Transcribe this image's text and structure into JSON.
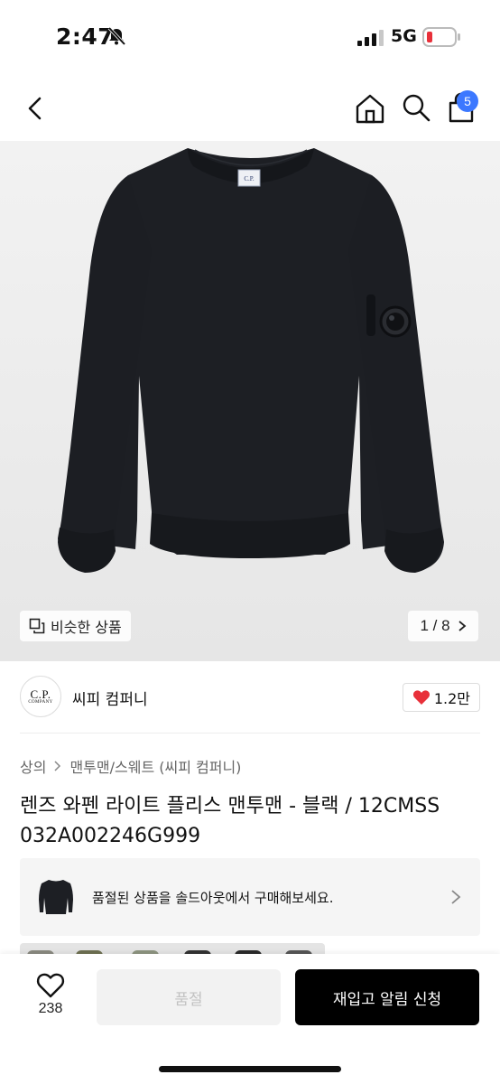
{
  "status_bar": {
    "time": "2:47",
    "network": "5G"
  },
  "nav": {
    "cart_count": "5",
    "icons": [
      "back-icon",
      "home-icon",
      "search-icon",
      "cart-icon"
    ]
  },
  "hero": {
    "similar_label": "비슷한 상품",
    "page_indicator": "1 / 8",
    "logo_label": "C.P."
  },
  "brand": {
    "logo_line1": "C.P.",
    "logo_line2": "COMPANY",
    "name": "씨피 컴퍼니",
    "likes": "1.2만"
  },
  "breadcrumb": {
    "level1": "상의",
    "level2": "맨투맨/스웨트 (씨피 컴퍼니)"
  },
  "product": {
    "title_line1": "렌즈 와펜 라이트 플리스 맨투맨 - 블랙 / 12CMSS",
    "title_line2": "032A002246G999"
  },
  "soldout_banner": {
    "text": "품절된 상품을 솔드아웃에서 구매해보세요."
  },
  "bottom_bar": {
    "wish_count": "238",
    "soldout_label": "품절",
    "restock_label": "재입고 알림 신청"
  },
  "colors": {
    "accent_badge": "#3c78ff",
    "heart_red": "#e8303a",
    "battery_red": "#e8303a",
    "garment": "#1d1f24"
  }
}
